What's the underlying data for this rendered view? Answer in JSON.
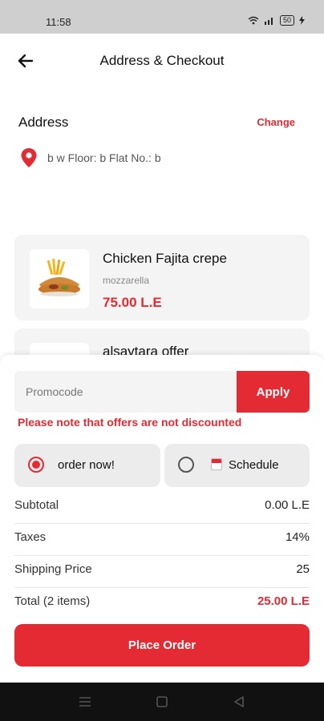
{
  "status_bar": {
    "time": "11:58",
    "battery": "50"
  },
  "header": {
    "title": "Address & Checkout",
    "back_icon": "arrow-left-icon"
  },
  "address": {
    "heading": "Address",
    "change_label": "Change",
    "line": "b w Floor: b  Flat No.: b",
    "icon": "map-pin-icon"
  },
  "cart": {
    "items": [
      {
        "name": "Chicken Fajita crepe",
        "subtitle": "mozzarella",
        "price": "75.00 L.E"
      },
      {
        "name": "alsaytara offer"
      }
    ]
  },
  "promo": {
    "placeholder": "Promocode",
    "value": "",
    "apply_label": "Apply",
    "note": "Please note that offers are not discounted"
  },
  "delivery_options": {
    "now_label": "order now!",
    "schedule_label": "Schedule",
    "selected": "now"
  },
  "summary": {
    "subtotal_label": "Subtotal",
    "subtotal_value": "0.00 L.E",
    "taxes_label": "Taxes",
    "taxes_value": "14%",
    "shipping_label": "Shipping Price",
    "shipping_value": "25",
    "total_label": "Total (2 items)",
    "total_value": "25.00 L.E"
  },
  "place_order_label": "Place Order",
  "colors": {
    "accent": "#e42b33",
    "card_bg": "#f4f4f4",
    "status_bg": "#cfcfcf",
    "nav_bg": "#111111"
  }
}
